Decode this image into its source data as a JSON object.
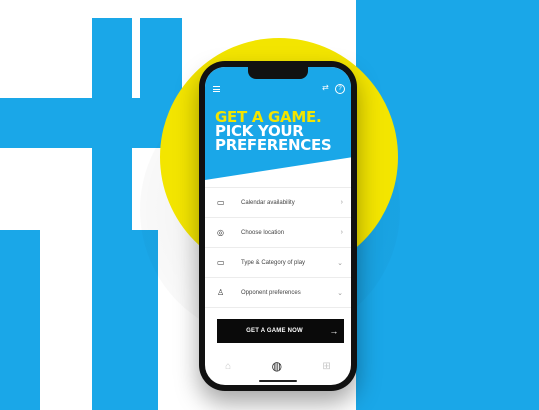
{
  "colors": {
    "blue": "#1aa7e8",
    "yellow": "#f3e500",
    "dark": "#0a0a0a"
  },
  "header": {
    "menu_icon": "hamburger-icon",
    "swap_icon": "swap-icon",
    "help_icon": "help-icon"
  },
  "hero": {
    "line1": "GET A GAME.",
    "line2": "PICK YOUR",
    "line3": "PREFERENCES"
  },
  "menu": {
    "items": [
      {
        "icon": "calendar-icon",
        "label": "Calendar availability",
        "arrow": "›"
      },
      {
        "icon": "location-pin-icon",
        "label": "Choose location",
        "arrow": "›"
      },
      {
        "icon": "court-icon",
        "label": "Type & Category of play",
        "arrow": "⌄"
      },
      {
        "icon": "person-icon",
        "label": "Opponent preferences",
        "arrow": "⌄"
      }
    ]
  },
  "cta": {
    "label": "GET A GAME NOW",
    "arrow": "→"
  },
  "tabbar": {
    "tabs": [
      {
        "icon": "home-icon"
      },
      {
        "icon": "tennis-ball-icon"
      },
      {
        "icon": "gamepad-icon"
      }
    ]
  }
}
